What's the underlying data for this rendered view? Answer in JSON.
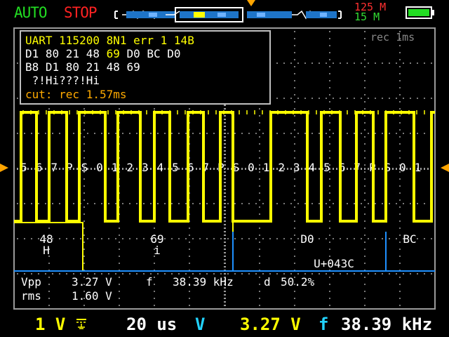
{
  "header": {
    "mode": "AUTO",
    "state": "STOP",
    "memory_total": "125 M",
    "memory_used": "15 M"
  },
  "decoder": {
    "line1": "UART 115200 8N1 err 1 14B",
    "line2_a": "D1 80 21 48 ",
    "line2_b": "69",
    "line2_c": " D0 BC D0",
    "line3": "B8 D1 80 21 48 69",
    "line4": " ?!Hi???!Hi",
    "line5": "cut: rec 1.57ms"
  },
  "record_label": "rec 1ms",
  "bit_labels": [
    "5",
    "6",
    "7",
    "P",
    "S",
    "0",
    "1",
    "2",
    "3",
    "4",
    "5",
    "6",
    "7",
    "P",
    "S",
    "0",
    "1",
    "2",
    "3",
    "4",
    "5",
    "6",
    "7",
    "P",
    "S",
    "0",
    "1"
  ],
  "frames": [
    {
      "hex": "48",
      "char": "H"
    },
    {
      "hex": "69",
      "char": "i"
    },
    {
      "hex": "D0",
      "char": "U+043C"
    },
    {
      "hex": "BC",
      "char": ""
    }
  ],
  "measurements": {
    "vpp_label": "Vpp",
    "vpp_value": "3.27 V",
    "f_label": "f",
    "f_value": "38.39 kHz",
    "d_label": "d",
    "d_value": "50.2%",
    "rms_label": "rms",
    "rms_value": "1.60 V"
  },
  "footer": {
    "volts_div": "1 V",
    "coupling_icon": "dc-coupling-icon",
    "time_div": "20 us",
    "meas1_name": "V",
    "meas1_value": "3.27 V",
    "meas2_name": "f",
    "meas2_value": "38.39 kHz"
  },
  "colors": {
    "trace": "#ffff00",
    "grid": "#808080",
    "auto": "#22dd22",
    "stop": "#ff2222",
    "accent": "#22d3ff",
    "decoder_line": "#1e90ff",
    "marker": "#ffa500"
  },
  "battery_level": 1.0
}
